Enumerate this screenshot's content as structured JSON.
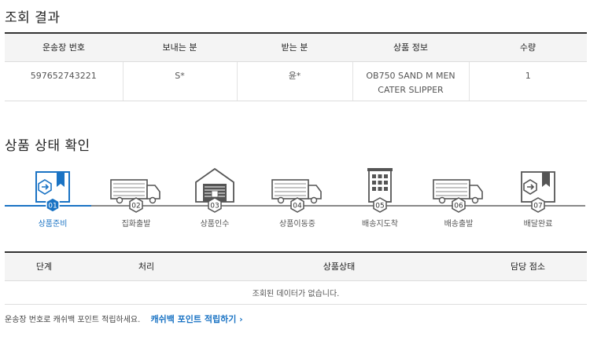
{
  "result": {
    "title": "조회 결과",
    "headers": [
      "운송장 번호",
      "보내는 분",
      "받는 분",
      "상품 정보",
      "수량"
    ],
    "row": {
      "tracking_no": "597652743221",
      "sender": "S*",
      "receiver": "윤*",
      "product_line1": "OB750 SAND M MEN",
      "product_line2": "CATER SLIPPER",
      "quantity": "1"
    }
  },
  "status": {
    "title": "상품 상태 확인",
    "steps": [
      {
        "num": "01",
        "label": "상품준비",
        "icon": "package-icon"
      },
      {
        "num": "02",
        "label": "집화출발",
        "icon": "truck-icon"
      },
      {
        "num": "03",
        "label": "상품인수",
        "icon": "warehouse-icon"
      },
      {
        "num": "04",
        "label": "상품이동중",
        "icon": "truck-icon"
      },
      {
        "num": "05",
        "label": "배송지도착",
        "icon": "building-icon"
      },
      {
        "num": "06",
        "label": "배송출발",
        "icon": "truck-icon"
      },
      {
        "num": "07",
        "label": "배달완료",
        "icon": "package-icon"
      }
    ],
    "active_step": 0,
    "colors": {
      "active": "#1a73c4",
      "inactive": "#555555"
    }
  },
  "detail": {
    "headers": [
      "단계",
      "처리",
      "상품상태",
      "담당 점소"
    ],
    "empty_message": "조회된 데이터가 없습니다."
  },
  "footer": {
    "text": "운송장 번호로 캐쉬백 포인트 적립하세요.",
    "link": "캐쉬백 포인트 적립하기 ›"
  }
}
